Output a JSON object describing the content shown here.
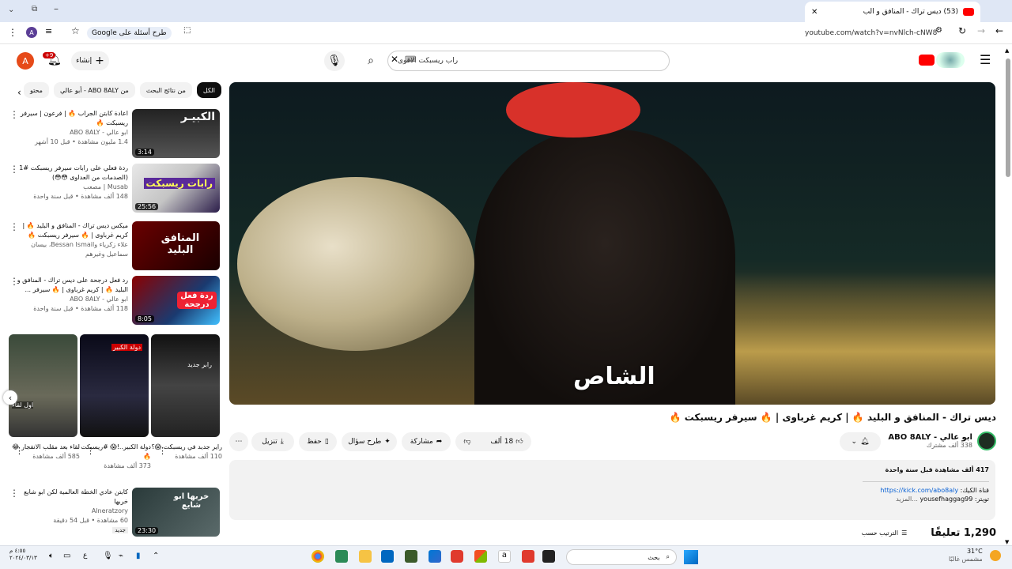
{
  "browser": {
    "tab_title": "(53) ديس تراك - المنافق و الب",
    "url": "youtube.com/watch?v=nvNlch-cNW8",
    "google_chip": "طرح أسئلة على Google",
    "profile_letter": "A"
  },
  "header": {
    "search_value": "راب ريسبكت الاقوى",
    "create_label": "إنشاء",
    "notif_badge": "+9",
    "avatar_letter": "A"
  },
  "player": {
    "caption": "الشاص"
  },
  "video": {
    "title": "ديس تراك - المنافق و البليد 🔥 | كريم غرباوى | 🔥 سيرفر ريسبكت 🔥",
    "channel_name": "ابو عالي - ABO 8ALY",
    "subscribers": "338 ألف مشترك",
    "likes": "18 ألف",
    "share_label": "مشاركة",
    "ask_label": "طرح سؤال",
    "save_label": "حفظ",
    "download_label": "تنزيل"
  },
  "description": {
    "views": "417 ألف مشاهدة  قبل سنة واحدة",
    "kick_label": "قناة الكيك:",
    "kick_link": "https://kick.com/abo8aly",
    "twitter": "تويتر: yousefhaggag99",
    "more": "...المزيد"
  },
  "comments": {
    "count": "1,290 تعليقًا",
    "sort_label": "الترتيب حسب"
  },
  "chips": [
    "الكل",
    "من نتائج البحث",
    "من ABO 8ALY - أبو عالي",
    "محتو"
  ],
  "recommendations": [
    {
      "title": "اعادة كابتن الجراب 🔥 | فرعون | سيرفر ريسبكت 🔥",
      "channel": "ابو عالي - ABO 8ALY",
      "meta": "1.4 مليون مشاهدة • قبل 10 أشهر",
      "duration": "3:14",
      "thumb_text": "الكبيـر"
    },
    {
      "title": "ردة فعلي على رابات سيرفر ريسبكت #1 (الصدمات من العداوى 😳😳)",
      "channel": "Musab | مصعب",
      "meta": "148 ألف مشاهدة • قبل سنة واحدة",
      "duration": "25:56",
      "thumb_text": "رابات ريسبكت"
    },
    {
      "title": "ميكس ديس تراك - المنافق و البليد 🔥 | كريم غرباوى | 🔥 سيرفر ريسبكت 🔥",
      "channel": "علاء زكرياء وBessan Ismail، بيسان سماعيل وغيرهم",
      "meta": "",
      "duration": "",
      "thumb_text": "المنافق البليد"
    },
    {
      "title": "رد فعل درجحة على ديس تراك - المنافق و البليد 🔥 | كريم غرباوى | 🔥 سيرفر ...",
      "channel": "ابو عالي - ABO 8ALY",
      "meta": "118 ألف مشاهدة • قبل سنة واحدة",
      "duration": "8:05",
      "thumb_text": "ردة فعل درجحة"
    }
  ],
  "shorts": [
    {
      "title": "راير جديد في ريسبكت 😱؟",
      "views": "110 ألف مشاهدة",
      "thumb_text": "رابر جديد"
    },
    {
      "title": "دولة الكبير..!😱 #ريسبكت 🔥",
      "views": "373 ألف مشاهدة",
      "thumb_text": "دولة الكبير"
    },
    {
      "title": "لقاء بعد مقلب الانفجار 😂",
      "views": "585 ألف مشاهدة",
      "thumb_text": "اول لقاء"
    }
  ],
  "last_rec": {
    "title": "كابتن عادي الخطة العالمية لكن ابو شايع خربها",
    "channel": "Alneratzory",
    "meta": "60 مشاهدة • قبل 54 دقيقة",
    "badge": "جديد",
    "duration": "23:30",
    "thumb_text": "خربها ابو شايع"
  },
  "taskbar": {
    "weather_temp": "31°C",
    "weather_desc": "مشمس غالبًا",
    "search_placeholder": "بحث",
    "time": "٤:٥٥ م",
    "date": "٢٠٢٤/٠٣/١٣"
  },
  "colors": {
    "youtube_red": "#ff0000",
    "link_blue": "#065fd4",
    "chip_dark": "#0f0f0f"
  }
}
